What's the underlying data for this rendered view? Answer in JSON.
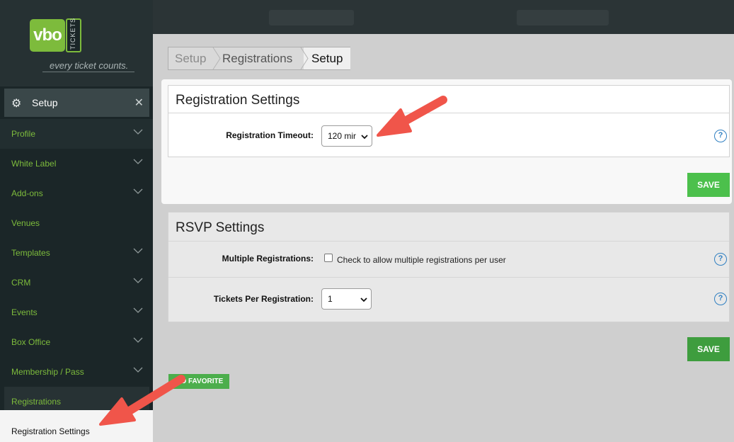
{
  "brand": {
    "logo_text": "vbo",
    "logo_tab": "TICKETS",
    "tagline": "every ticket counts."
  },
  "sidebar": {
    "header_label": "Setup",
    "items": [
      {
        "label": "Profile",
        "chevron": true
      },
      {
        "label": "White Label",
        "chevron": true
      },
      {
        "label": "Add-ons",
        "chevron": true
      },
      {
        "label": "Venues",
        "chevron": false
      },
      {
        "label": "Templates",
        "chevron": true
      },
      {
        "label": "CRM",
        "chevron": true
      },
      {
        "label": "Events",
        "chevron": true
      },
      {
        "label": "Box Office",
        "chevron": true
      },
      {
        "label": "Membership / Pass",
        "chevron": true
      },
      {
        "label": "Registrations",
        "chevron": false
      }
    ],
    "sub_item": "Registration Settings"
  },
  "breadcrumb": [
    "Setup",
    "Registrations",
    "Setup"
  ],
  "registration_settings": {
    "title": "Registration Settings",
    "timeout_label": "Registration Timeout:",
    "timeout_value": "120 mir",
    "save_label": "SAVE"
  },
  "rsvp_settings": {
    "title": "RSVP Settings",
    "multiple_label": "Multiple Registrations:",
    "multiple_checkbox_text": "Check to allow multiple registrations per user",
    "tickets_label": "Tickets Per Registration:",
    "tickets_value": "1",
    "save_label": "SAVE"
  },
  "favorite_label": "D FAVORITE",
  "help_glyph": "?",
  "colors": {
    "sidebar_bg": "#1b2628",
    "brand_green": "#7dbb3c",
    "save_green": "#4cc04c",
    "help_blue": "#2f7fc1",
    "annotation_arrow": "#f0554a"
  }
}
